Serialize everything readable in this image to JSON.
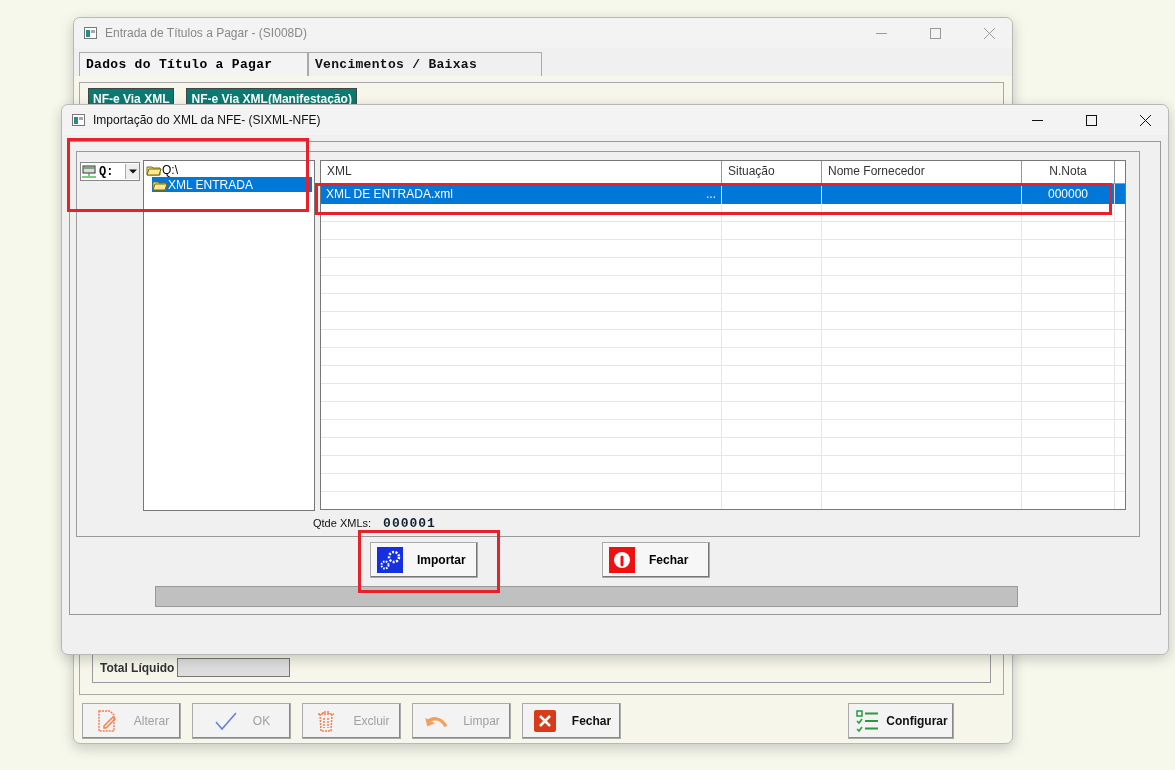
{
  "main_window": {
    "title": "Entrada de Títulos a Pagar - (SI008D)",
    "tabs": [
      {
        "label": "Dados do Título a Pagar",
        "selected": true
      },
      {
        "label": "Vencimentos / Baixas",
        "selected": false
      }
    ],
    "xml_buttons": [
      "NF-e Via XML",
      "NF-e Via XML(Manifestação)"
    ],
    "total": {
      "label": "Total Líquido"
    },
    "buttons": [
      {
        "label": "Alterar",
        "kind": "edit",
        "disabled": true
      },
      {
        "label": "OK",
        "kind": "ok",
        "disabled": true
      },
      {
        "label": "Excluir",
        "kind": "delete",
        "disabled": true
      },
      {
        "label": "Limpar",
        "kind": "undo",
        "disabled": true
      },
      {
        "label": "Fechar",
        "kind": "close",
        "disabled": false
      },
      {
        "label": "Configurar",
        "kind": "config",
        "disabled": false
      }
    ]
  },
  "dialog": {
    "title": "Importação do XML da NFE- (SIXML-NFE)",
    "drive": "Q:",
    "folders": [
      {
        "label": "Q:\\",
        "selected": false,
        "children": [
          {
            "label": "XML ENTRADA",
            "selected": true
          }
        ]
      }
    ],
    "table": {
      "columns": [
        "XML",
        "Situação",
        "Nome Fornecedor",
        "N.Nota"
      ],
      "rows": [
        {
          "cells": [
            "XML DE ENTRADA.xml",
            "",
            "",
            "000000"
          ],
          "more": "...",
          "selected": true
        }
      ]
    },
    "count_label": "Qtde XMLs:",
    "count": "000001",
    "buttons": [
      {
        "label": "Importar",
        "kind": "import"
      },
      {
        "label": "Fechar",
        "kind": "close"
      }
    ],
    "progress": {
      "level": 0
    }
  }
}
